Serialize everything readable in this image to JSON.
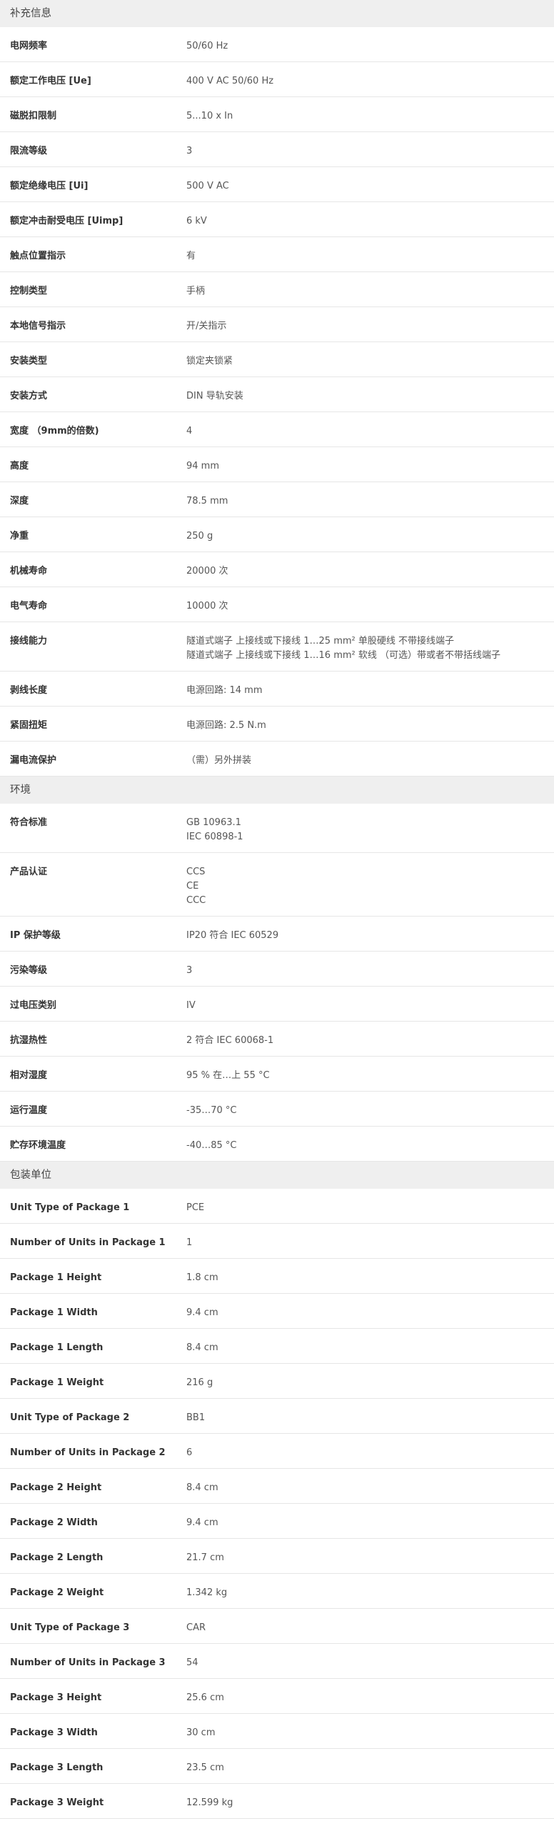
{
  "sections": [
    {
      "title": "补充信息",
      "rows": [
        {
          "label": "电网频率",
          "values": [
            "50/60 Hz"
          ]
        },
        {
          "label": "额定工作电压 [Ue]",
          "values": [
            "400 V AC 50/60 Hz"
          ]
        },
        {
          "label": "磁脱扣限制",
          "values": [
            "5...10 x In"
          ]
        },
        {
          "label": "限流等级",
          "values": [
            "3"
          ]
        },
        {
          "label": "额定绝缘电压 [Ui]",
          "values": [
            "500 V AC"
          ]
        },
        {
          "label": "额定冲击耐受电压 [Uimp]",
          "values": [
            "6 kV"
          ]
        },
        {
          "label": "触点位置指示",
          "values": [
            "有"
          ]
        },
        {
          "label": "控制类型",
          "values": [
            "手柄"
          ]
        },
        {
          "label": "本地信号指示",
          "values": [
            "开/关指示"
          ]
        },
        {
          "label": "安装类型",
          "values": [
            "锁定夹锁紧"
          ]
        },
        {
          "label": "安装方式",
          "values": [
            "DIN 导轨安装"
          ]
        },
        {
          "label": "宽度 （9mm的倍数)",
          "values": [
            "4"
          ]
        },
        {
          "label": "高度",
          "values": [
            "94 mm"
          ]
        },
        {
          "label": "深度",
          "values": [
            "78.5 mm"
          ]
        },
        {
          "label": "净重",
          "values": [
            "250 g"
          ]
        },
        {
          "label": "机械寿命",
          "values": [
            "20000 次"
          ]
        },
        {
          "label": "电气寿命",
          "values": [
            "10000 次"
          ]
        },
        {
          "label": "接线能力",
          "values": [
            "隧道式端子 上接线或下接线 1…25 mm² 单股硬线 不带接线端子",
            "隧道式端子 上接线或下接线 1…16 mm² 软线 （可选）带或者不带括线端子"
          ]
        },
        {
          "label": "剥线长度",
          "values": [
            "电源回路: 14 mm"
          ]
        },
        {
          "label": "紧固扭矩",
          "values": [
            "电源回路: 2.5 N.m"
          ]
        },
        {
          "label": "漏电流保护",
          "values": [
            "（需）另外拼装"
          ]
        }
      ]
    },
    {
      "title": "环境",
      "rows": [
        {
          "label": "符合标准",
          "values": [
            "GB 10963.1",
            "IEC 60898-1"
          ]
        },
        {
          "label": "产品认证",
          "values": [
            "CCS",
            "CE",
            "CCC"
          ]
        },
        {
          "label": "IP 保护等级",
          "values": [
            "IP20 符合 IEC 60529"
          ]
        },
        {
          "label": "污染等级",
          "values": [
            "3"
          ]
        },
        {
          "label": "过电压类别",
          "values": [
            "IV"
          ]
        },
        {
          "label": "抗湿热性",
          "values": [
            "2 符合 IEC 60068-1"
          ]
        },
        {
          "label": "相对湿度",
          "values": [
            "95 % 在…上 55 °C"
          ]
        },
        {
          "label": "运行温度",
          "values": [
            "-35…70 °C"
          ]
        },
        {
          "label": "贮存环境温度",
          "values": [
            "-40…85 °C"
          ]
        }
      ]
    },
    {
      "title": "包装单位",
      "rows": [
        {
          "label": "Unit Type of Package 1",
          "values": [
            "PCE"
          ]
        },
        {
          "label": "Number of Units in Package 1",
          "values": [
            "1"
          ]
        },
        {
          "label": "Package 1 Height",
          "values": [
            "1.8 cm"
          ]
        },
        {
          "label": "Package 1 Width",
          "values": [
            "9.4 cm"
          ]
        },
        {
          "label": "Package 1 Length",
          "values": [
            "8.4 cm"
          ]
        },
        {
          "label": "Package 1 Weight",
          "values": [
            "216 g"
          ]
        },
        {
          "label": "Unit Type of Package 2",
          "values": [
            "BB1"
          ]
        },
        {
          "label": "Number of Units in Package 2",
          "values": [
            "6"
          ]
        },
        {
          "label": "Package 2 Height",
          "values": [
            "8.4 cm"
          ]
        },
        {
          "label": "Package 2 Width",
          "values": [
            "9.4 cm"
          ]
        },
        {
          "label": "Package 2 Length",
          "values": [
            "21.7 cm"
          ]
        },
        {
          "label": "Package 2 Weight",
          "values": [
            "1.342 kg"
          ]
        },
        {
          "label": "Unit Type of Package 3",
          "values": [
            "CAR"
          ]
        },
        {
          "label": "Number of Units in Package 3",
          "values": [
            "54"
          ]
        },
        {
          "label": "Package 3 Height",
          "values": [
            "25.6 cm"
          ]
        },
        {
          "label": "Package 3 Width",
          "values": [
            "30 cm"
          ]
        },
        {
          "label": "Package 3 Length",
          "values": [
            "23.5 cm"
          ]
        },
        {
          "label": "Package 3 Weight",
          "values": [
            "12.599 kg"
          ]
        }
      ]
    }
  ]
}
